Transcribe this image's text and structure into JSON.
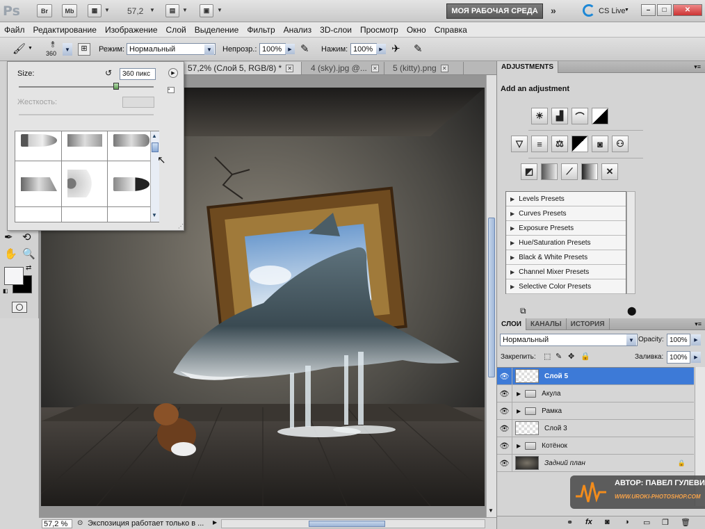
{
  "app": {
    "logo": "Ps",
    "btn_br": "Br",
    "btn_mb": "Mb",
    "zoom_display": "57,2",
    "workspace_label": "МОЯ РАБОЧАЯ СРЕДА",
    "cslive_label": "CS Live"
  },
  "menu": [
    "Файл",
    "Редактирование",
    "Изображение",
    "Слой",
    "Выделение",
    "Фильтр",
    "Анализ",
    "3D-слои",
    "Просмотр",
    "Окно",
    "Справка"
  ],
  "options": {
    "brush_size": "360",
    "mode_label": "Режим:",
    "mode_value": "Нормальный",
    "opacity_label": "Непрозр.:",
    "opacity_value": "100%",
    "flow_label": "Нажим:",
    "flow_value": "100%"
  },
  "brush_picker": {
    "size_label": "Size:",
    "size_value": "360 пикс",
    "hardness_label": "Жесткость:",
    "size_slider_pos": 0.72
  },
  "tabs": [
    {
      "label": "57,2% (Слой 5, RGB/8) *",
      "active": true
    },
    {
      "label": "4 (sky).jpg @...",
      "active": false
    },
    {
      "label": "5 (kitty).png",
      "active": false
    }
  ],
  "status": {
    "zoom": "57,2 %",
    "message": "Экспозиция работает только в ..."
  },
  "adjustments": {
    "panel_title": "ADJUSTMENTS",
    "subtitle": "Add an adjustment",
    "presets": [
      "Levels Presets",
      "Curves Presets",
      "Exposure Presets",
      "Hue/Saturation Presets",
      "Black & White Presets",
      "Channel Mixer Presets",
      "Selective Color Presets"
    ]
  },
  "layers_panel": {
    "tabs": [
      "СЛОИ",
      "КАНАЛЫ",
      "ИСТОРИЯ"
    ],
    "blend_mode": "Нормальный",
    "opacity_label": "Opacity:",
    "opacity_value": "100%",
    "lock_label": "Закрепить:",
    "fill_label": "Заливка:",
    "fill_value": "100%",
    "layers": [
      {
        "name": "Слой 5",
        "type": "layer",
        "selected": true
      },
      {
        "name": "Акула",
        "type": "group",
        "selected": false
      },
      {
        "name": "Рамка",
        "type": "group",
        "selected": false
      },
      {
        "name": "Слой 3",
        "type": "layer",
        "selected": false
      },
      {
        "name": "Котёнок",
        "type": "group",
        "selected": false
      },
      {
        "name": "Задний план",
        "type": "background",
        "selected": false
      }
    ]
  },
  "watermark": {
    "author": "АВТОР: ПАВЕЛ ГУЛЕВИЧ",
    "site": "WWW.UROKI-PHOTOSHOP.COM"
  }
}
